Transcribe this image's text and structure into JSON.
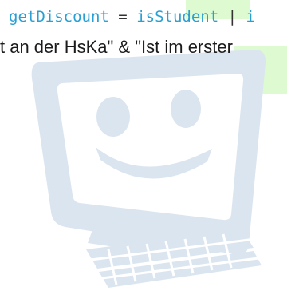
{
  "code": {
    "tok1": "getDiscount",
    "tok2": "=",
    "tok3": "isStudent",
    "tok4": "|",
    "tok5": "i"
  },
  "text": {
    "line": "t an der HsKa\" & \"Ist im erster"
  },
  "illustration": {
    "name": "smiling-computer-icon",
    "color": "#dbe5ef",
    "accent_color": "#ddfad0"
  }
}
